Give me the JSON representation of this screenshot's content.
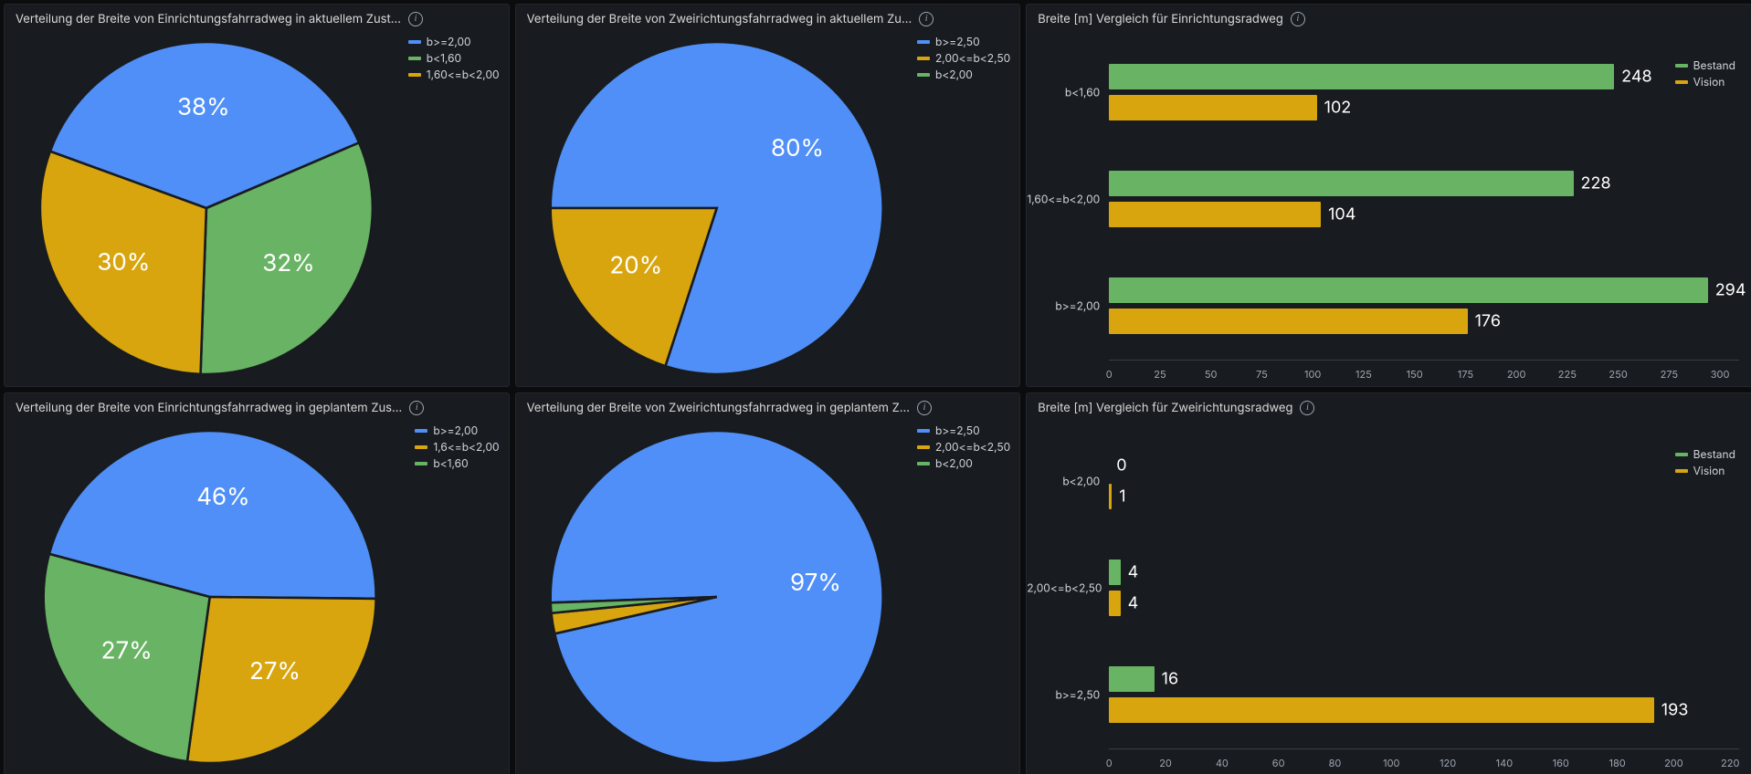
{
  "colors": {
    "blue": "#4f8ff7",
    "green": "#69b364",
    "gold": "#d8a50f"
  },
  "panels": {
    "pie_einrichtung_ist": {
      "title": "Verteilung der Breite von Einrichtungsfahrradweg in aktuellem Zust…",
      "legend": [
        {
          "color": "blue",
          "label": "b>=2,00"
        },
        {
          "color": "green",
          "label": "b<1,60"
        },
        {
          "color": "gold",
          "label": "1,60<=b<2,00"
        }
      ],
      "slices": [
        {
          "label": "38%",
          "color": "blue",
          "value": 38
        },
        {
          "label": "32%",
          "color": "green",
          "value": 32
        },
        {
          "label": "30%",
          "color": "gold",
          "value": 30
        }
      ]
    },
    "pie_zweirichtung_ist": {
      "title": "Verteilung der Breite von Zweirichtungsfahrradweg in aktuellem Zu…",
      "legend": [
        {
          "color": "blue",
          "label": "b>=2,50"
        },
        {
          "color": "gold",
          "label": "2,00<=b<2,50"
        },
        {
          "color": "green",
          "label": "b<2,00"
        }
      ],
      "slices": [
        {
          "label": "80%",
          "color": "blue",
          "value": 80
        },
        {
          "label": "20%",
          "color": "gold",
          "value": 20
        }
      ]
    },
    "pie_einrichtung_plan": {
      "title": "Verteilung der Breite von Einrichtungsfahrradweg in geplantem Zus…",
      "legend": [
        {
          "color": "blue",
          "label": "b>=2,00"
        },
        {
          "color": "gold",
          "label": "1,6<=b<2,00"
        },
        {
          "color": "green",
          "label": "b<1,60"
        }
      ],
      "slices": [
        {
          "label": "46%",
          "color": "blue",
          "value": 46
        },
        {
          "label": "27%",
          "color": "gold",
          "value": 27
        },
        {
          "label": "27%",
          "color": "green",
          "value": 27
        }
      ]
    },
    "pie_zweirichtung_plan": {
      "title": "Verteilung der Breite von Zweirichtungsfahrradweg in geplantem Z…",
      "legend": [
        {
          "color": "blue",
          "label": "b>=2,50"
        },
        {
          "color": "gold",
          "label": "2,00<=b<2,50"
        },
        {
          "color": "green",
          "label": "b<2,00"
        }
      ],
      "slices": [
        {
          "label": "97%",
          "color": "blue",
          "value": 97
        },
        {
          "label": "",
          "color": "gold",
          "value": 2
        },
        {
          "label": "",
          "color": "green",
          "value": 1
        }
      ]
    },
    "bar_einrichtung": {
      "title": "Breite [m] Vergleich für Einrichtungsradweg",
      "legend": [
        {
          "color": "green",
          "label": "Bestand"
        },
        {
          "color": "gold",
          "label": "Vision"
        }
      ],
      "x_ticks": [
        "0",
        "25",
        "50",
        "75",
        "100",
        "125",
        "150",
        "175",
        "200",
        "225",
        "250",
        "275",
        "300"
      ],
      "x_max": 305,
      "categories": [
        "b<1,60",
        "1,60<=b<2,00",
        "b>=2,00"
      ],
      "series": {
        "Bestand": [
          248,
          228,
          294
        ],
        "Vision": [
          102,
          104,
          176
        ]
      }
    },
    "bar_zweirichtung": {
      "title": "Breite [m] Vergleich für Zweirichtungsradweg",
      "legend": [
        {
          "color": "green",
          "label": "Bestand"
        },
        {
          "color": "gold",
          "label": "Vision"
        }
      ],
      "x_ticks": [
        "0",
        "20",
        "40",
        "60",
        "80",
        "100",
        "120",
        "140",
        "160",
        "180",
        "200",
        "220"
      ],
      "x_max": 220,
      "categories": [
        "b<2,00",
        "2,00<=b<2,50",
        "b>=2,50"
      ],
      "series": {
        "Bestand": [
          0,
          4,
          16
        ],
        "Vision": [
          1,
          4,
          193
        ]
      }
    }
  },
  "chart_data": [
    {
      "type": "pie",
      "title": "Verteilung der Breite von Einrichtungsfahrradweg in aktuellem Zustand",
      "series": [
        {
          "name": "b>=2,00",
          "value": 38
        },
        {
          "name": "b<1,60",
          "value": 32
        },
        {
          "name": "1,60<=b<2,00",
          "value": 30
        }
      ]
    },
    {
      "type": "pie",
      "title": "Verteilung der Breite von Zweirichtungsfahrradweg in aktuellem Zustand",
      "series": [
        {
          "name": "b>=2,50",
          "value": 80
        },
        {
          "name": "2,00<=b<2,50",
          "value": 20
        },
        {
          "name": "b<2,00",
          "value": 0
        }
      ]
    },
    {
      "type": "bar",
      "title": "Breite [m] Vergleich für Einrichtungsradweg",
      "categories": [
        "b<1,60",
        "1,60<=b<2,00",
        "b>=2,00"
      ],
      "series": [
        {
          "name": "Bestand",
          "values": [
            248,
            228,
            294
          ]
        },
        {
          "name": "Vision",
          "values": [
            102,
            104,
            176
          ]
        }
      ],
      "xlabel": "",
      "ylabel": "",
      "xlim": [
        0,
        300
      ]
    },
    {
      "type": "pie",
      "title": "Verteilung der Breite von Einrichtungsfahrradweg in geplantem Zustand",
      "series": [
        {
          "name": "b>=2,00",
          "value": 46
        },
        {
          "name": "1,6<=b<2,00",
          "value": 27
        },
        {
          "name": "b<1,60",
          "value": 27
        }
      ]
    },
    {
      "type": "pie",
      "title": "Verteilung der Breite von Zweirichtungsfahrradweg in geplantem Zustand",
      "series": [
        {
          "name": "b>=2,50",
          "value": 97
        },
        {
          "name": "2,00<=b<2,50",
          "value": 2
        },
        {
          "name": "b<2,00",
          "value": 1
        }
      ]
    },
    {
      "type": "bar",
      "title": "Breite [m] Vergleich für Zweirichtungsradweg",
      "categories": [
        "b<2,00",
        "2,00<=b<2,50",
        "b>=2,50"
      ],
      "series": [
        {
          "name": "Bestand",
          "values": [
            0,
            4,
            16
          ]
        },
        {
          "name": "Vision",
          "values": [
            1,
            4,
            193
          ]
        }
      ],
      "xlabel": "",
      "ylabel": "",
      "xlim": [
        0,
        220
      ]
    }
  ]
}
